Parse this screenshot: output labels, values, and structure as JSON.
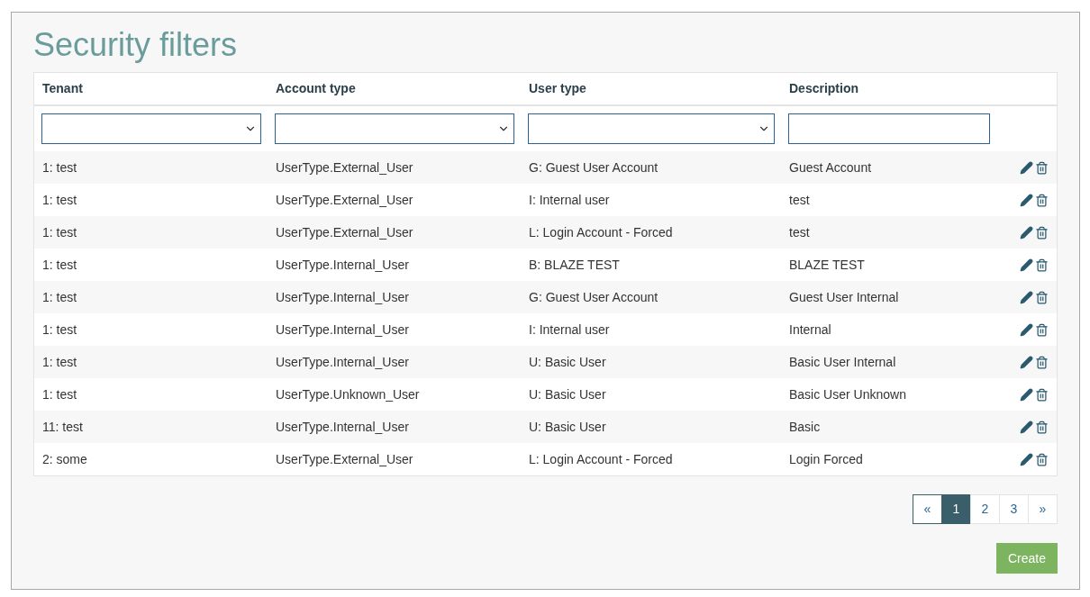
{
  "title": "Security filters",
  "table": {
    "columns": [
      "Tenant",
      "Account type",
      "User type",
      "Description"
    ],
    "filters": [
      {
        "kind": "select"
      },
      {
        "kind": "select"
      },
      {
        "kind": "select"
      },
      {
        "kind": "text"
      }
    ],
    "rows": [
      {
        "cells": [
          "1: test",
          "UserType.External_User",
          "G: Guest User Account",
          "Guest Account"
        ]
      },
      {
        "cells": [
          "1: test",
          "UserType.External_User",
          "I: Internal user",
          "test"
        ]
      },
      {
        "cells": [
          "1: test",
          "UserType.External_User",
          "L: Login Account - Forced",
          "test"
        ]
      },
      {
        "cells": [
          "1: test",
          "UserType.Internal_User",
          "B: BLAZE TEST",
          "BLAZE TEST"
        ]
      },
      {
        "cells": [
          "1: test",
          "UserType.Internal_User",
          "G: Guest User Account",
          "Guest User Internal"
        ]
      },
      {
        "cells": [
          "1: test",
          "UserType.Internal_User",
          "I: Internal user",
          "Internal"
        ]
      },
      {
        "cells": [
          "1: test",
          "UserType.Internal_User",
          "U: Basic User",
          "Basic User Internal"
        ]
      },
      {
        "cells": [
          "1: test",
          "UserType.Unknown_User",
          "U: Basic User",
          "Basic User Unknown"
        ]
      },
      {
        "cells": [
          "11: test",
          "UserType.Internal_User",
          "U: Basic User",
          "Basic"
        ]
      },
      {
        "cells": [
          "2: some",
          "UserType.External_User",
          "L: Login Account - Forced",
          "Login Forced"
        ]
      }
    ]
  },
  "pagination": [
    {
      "label": "«",
      "selected": false
    },
    {
      "label": "1",
      "selected": true
    },
    {
      "label": "2",
      "selected": false
    },
    {
      "label": "3",
      "selected": false
    },
    {
      "label": "»",
      "selected": false
    }
  ],
  "create_button": "Create"
}
